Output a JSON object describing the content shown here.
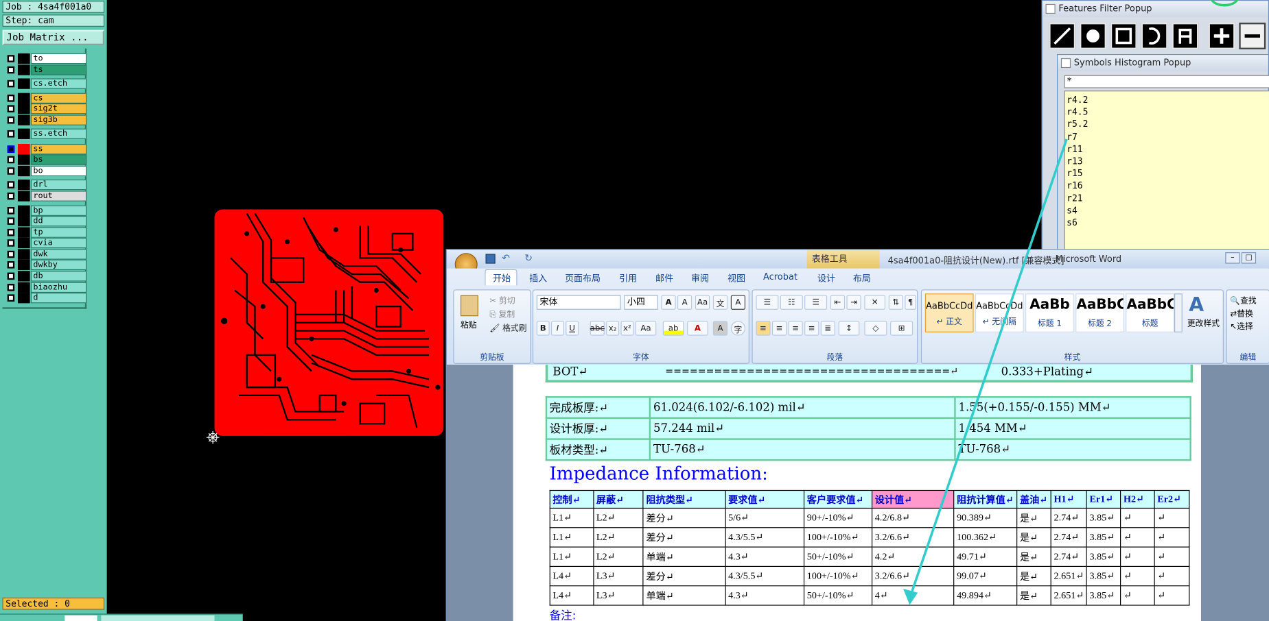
{
  "left_panel": {
    "job": "Job : 4sa4f001a0",
    "step": "Step: cam",
    "job_matrix_button": "Job Matrix ...",
    "selected": "Selected : 0",
    "layers": [
      {
        "name": "to",
        "color": "#ffffff"
      },
      {
        "name": "ts",
        "color": "#2e9e74"
      },
      {
        "name": "cs.etch",
        "color": "#8ae0d0"
      },
      {
        "name": "cs",
        "color": "#f5be3c"
      },
      {
        "name": "sig2t",
        "color": "#f5be3c"
      },
      {
        "name": "sig3b",
        "color": "#f5be3c"
      },
      {
        "name": "ss.etch",
        "color": "#8ae0d0"
      },
      {
        "name": "ss",
        "color": "#f5be3c"
      },
      {
        "name": "bs",
        "color": "#2e9e74"
      },
      {
        "name": "bo",
        "color": "#ffffff"
      },
      {
        "name": "drl",
        "color": "#8ae0d0"
      },
      {
        "name": "rout",
        "color": "#dddddd"
      },
      {
        "name": "bp",
        "color": "#8ae0d0"
      },
      {
        "name": "dd",
        "color": "#8ae0d0"
      },
      {
        "name": "tp",
        "color": "#8ae0d0"
      },
      {
        "name": "cvia",
        "color": "#8ae0d0"
      },
      {
        "name": "dwk",
        "color": "#8ae0d0"
      },
      {
        "name": "dwkby",
        "color": "#8ae0d0"
      },
      {
        "name": "db",
        "color": "#8ae0d0"
      },
      {
        "name": "biaozhu",
        "color": "#8ae0d0"
      },
      {
        "name": "d",
        "color": "#8ae0d0"
      }
    ]
  },
  "features_filter": {
    "title": "Features Filter Popup",
    "tools": [
      "line-tool",
      "pad-tool",
      "surface-tool",
      "arc-tool",
      "text-tool",
      "plus-tool",
      "minus-tool"
    ]
  },
  "symbols_histogram": {
    "title": "Symbols Histogram Popup",
    "filter": "*",
    "symbols": [
      "r4.2",
      "r4.5",
      "r5.2",
      "r7",
      "r11",
      "r13",
      "r15",
      "r16",
      "r21",
      "s4",
      "s6"
    ]
  },
  "word": {
    "title_doc": "4sa4f001a0-阻抗设计(New).rtf [兼容模式]",
    "title_app": "Microsoft Word",
    "table_tools": "表格工具",
    "tabs": [
      "开始",
      "插入",
      "页面布局",
      "引用",
      "邮件",
      "审阅",
      "视图",
      "Acrobat",
      "设计",
      "布局"
    ],
    "clipboard": {
      "paste": "粘贴",
      "cut": "剪切",
      "copy": "复制",
      "format_painter": "格式刷",
      "label": "剪贴板"
    },
    "font": {
      "name": "宋体",
      "size": "小四",
      "label": "字体"
    },
    "paragraph_label": "段落",
    "styles": {
      "label": "样式",
      "change": "更改样式",
      "items": [
        {
          "preview": "AaBbCcDd",
          "name": "↵ 正文"
        },
        {
          "preview": "AaBbCcDd",
          "name": "↵ 无间隔"
        },
        {
          "preview": "AaBb",
          "name": "标题 1"
        },
        {
          "preview": "AaBbC",
          "name": "标题 2"
        },
        {
          "preview": "AaBbC",
          "name": "标题"
        }
      ]
    },
    "editing": {
      "find": "查找",
      "replace": "替换",
      "select": "选择",
      "label": "编辑"
    },
    "document": {
      "bot_row": [
        "BOT↵",
        "===================================↵",
        "0.333+Plating↵"
      ],
      "thickness_rows": [
        [
          "完成板厚:↵",
          "61.024(6.102/-6.102) mil↵",
          "1.55(+0.155/-0.155) MM↵"
        ],
        [
          "设计板厚:↵",
          "57.244 mil↵",
          "1.454 MM↵"
        ],
        [
          "板材类型:↵",
          "TU-768↵",
          "TU-768↵"
        ]
      ],
      "impedance_heading": "Impedance Information:",
      "impedance_headers": [
        "控制↵",
        "屏蔽↵",
        "阻抗类型↵",
        "要求值↵",
        "客户要求值↵",
        "设计值↵",
        "阻抗计算值↵",
        "盖油↵",
        "H1↵",
        "Er1↵",
        "H2↵",
        "Er2↵"
      ],
      "impedance_rows": [
        [
          "L1↵",
          "L2↵",
          "差分↵",
          "5/6↵",
          "90+/-10%↵",
          "4.2/6.8↵",
          "90.389↵",
          "是↵",
          "2.74↵",
          "3.85↵",
          "↵",
          "↵"
        ],
        [
          "L1↵",
          "L2↵",
          "差分↵",
          "4.3/5.5↵",
          "100+/-10%↵",
          "3.2/6.6↵",
          "100.362↵",
          "是↵",
          "2.74↵",
          "3.85↵",
          "↵",
          "↵"
        ],
        [
          "L1↵",
          "L2↵",
          "单端↵",
          "4.3↵",
          "50+/-10%↵",
          "4.2↵",
          "49.71↵",
          "是↵",
          "2.74↵",
          "3.85↵",
          "↵",
          "↵"
        ],
        [
          "L4↵",
          "L3↵",
          "差分↵",
          "4.3/5.5↵",
          "100+/-10%↵",
          "3.2/6.6↵",
          "99.07↵",
          "是↵",
          "2.651↵",
          "3.85↵",
          "↵",
          "↵"
        ],
        [
          "L4↵",
          "L3↵",
          "单端↵",
          "4.3↵",
          "50+/-10%↵",
          "4↵",
          "49.894↵",
          "是↵",
          "2.651↵",
          "3.85↵",
          "↵",
          "↵"
        ]
      ],
      "note": "备注:"
    }
  },
  "colors": {
    "accent_teal": "#5ec8b0",
    "board_red": "#ff0000",
    "arrow": "#33cccc",
    "heading_blue": "#0000ff"
  }
}
